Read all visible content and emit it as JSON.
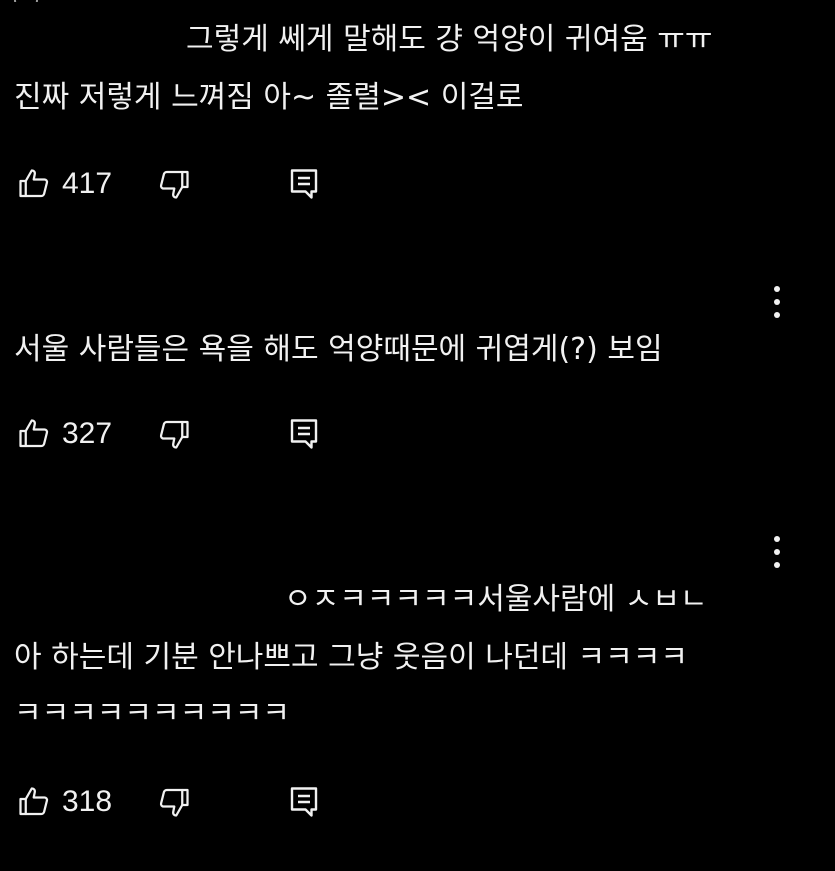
{
  "comments": [
    {
      "lines": [
        "그렇게 쎄게 말해도 걍 억양이 귀여움 ㅠㅠ",
        "진짜 저렇게 느껴짐 아~ 졸렬>< 이걸로"
      ],
      "likes": "417"
    },
    {
      "lines": [
        "서울 사람들은 욕을 해도 억양때문에 귀엽게(?) 보임"
      ],
      "likes": "327"
    },
    {
      "lines": [
        "ㅇㅈㅋㅋㅋㅋㅋ서울사람에 ㅅㅂㄴ",
        "아 하는데 기분 안나쁘고 그냥 웃음이 나던데 ㅋㅋㅋㅋ",
        "ㅋㅋㅋㅋㅋㅋㅋㅋㅋㅋ"
      ],
      "likes": "318"
    }
  ],
  "icons": {
    "like": "thumb-up-icon",
    "dislike": "thumb-down-icon",
    "reply": "reply-comment-icon",
    "more": "more-vertical-icon"
  },
  "colors": {
    "background": "#000000",
    "text": "#f1f1f1"
  }
}
